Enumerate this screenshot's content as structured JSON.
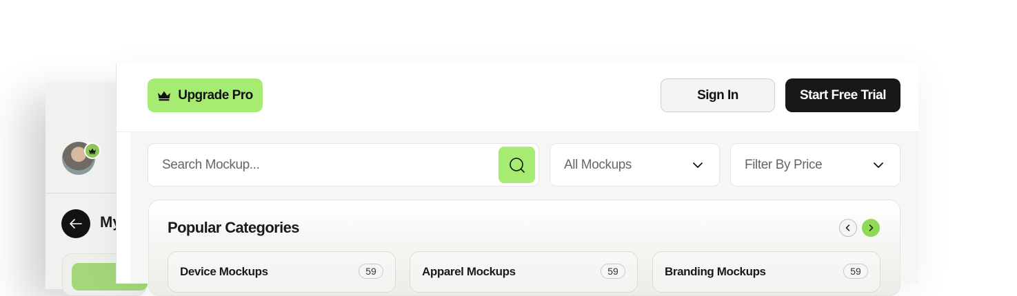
{
  "colors": {
    "accent_green": "#a6ec73",
    "dark": "#181818"
  },
  "sidebar": {
    "title_partial": "My"
  },
  "header": {
    "upgrade_label": "Upgrade Pro",
    "signin_label": "Sign In",
    "trial_label": "Start Free Trial"
  },
  "filters": {
    "search_placeholder": "Search Mockup...",
    "category_select": "All Mockups",
    "price_select": "Filter By Price"
  },
  "popular": {
    "title": "Popular Categories",
    "items": [
      {
        "name": "Device Mockups",
        "count": "59"
      },
      {
        "name": "Apparel Mockups",
        "count": "59"
      },
      {
        "name": "Branding Mockups",
        "count": "59"
      }
    ]
  },
  "icons": {
    "upgrade": "crown-icon",
    "search": "search-icon",
    "dropdown": "chevron-down-icon",
    "prev": "chevron-left-icon",
    "next": "chevron-right-icon",
    "back": "arrow-left-icon"
  }
}
